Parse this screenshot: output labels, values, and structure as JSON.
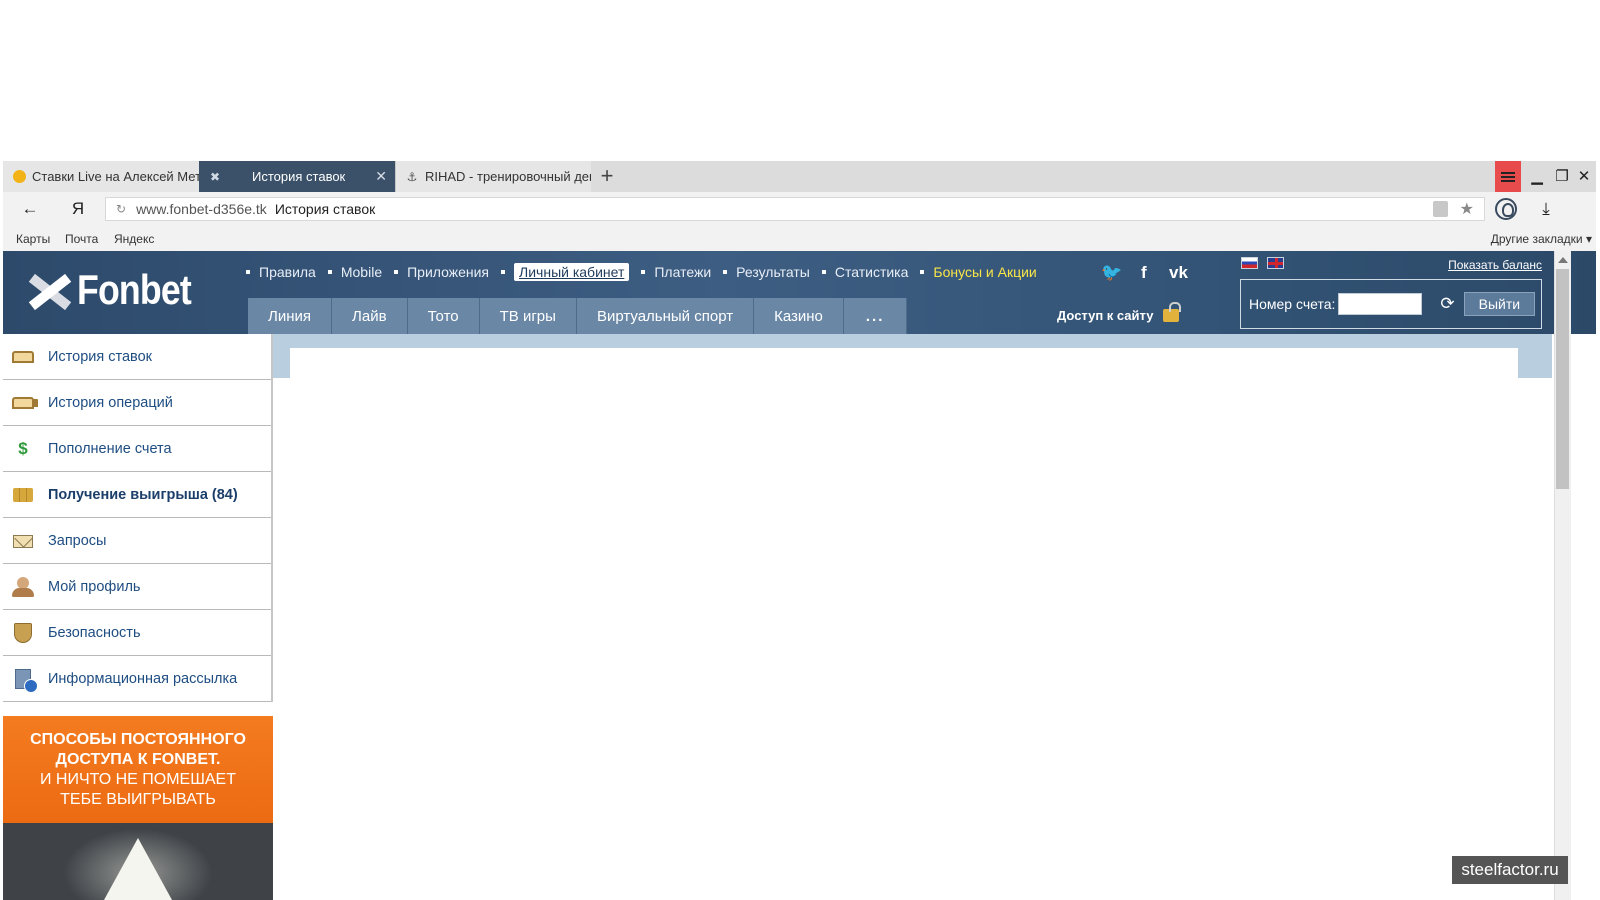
{
  "browser": {
    "tabs": [
      {
        "label": "Ставки Live на Алексей Метёлкин",
        "active": false
      },
      {
        "label": "История ставок",
        "active": true
      },
      {
        "label": "RIHAD - тренировочный день",
        "active": false
      }
    ],
    "new_tab_symbol": "+",
    "close_symbol": "✕",
    "back_symbol": "←",
    "yandex_button": "Я",
    "address": {
      "domain": "www.fonbet-d356e.tk",
      "page_title": "История ставок"
    },
    "bookmarks": [
      "Карты",
      "Почта",
      "Яндекс"
    ],
    "other_bookmarks": "Другие закладки ▾"
  },
  "site": {
    "logo_text": "Fonbet",
    "top_nav": [
      {
        "label": "Правила"
      },
      {
        "label": "Mobile"
      },
      {
        "label": "Приложения"
      },
      {
        "label": "Личный кабинет",
        "active": true
      },
      {
        "label": "Платежи"
      },
      {
        "label": "Результаты"
      },
      {
        "label": "Статистика"
      },
      {
        "label": "Бонусы и Акции",
        "promo": true
      }
    ],
    "social": {
      "twitter": "🐦",
      "facebook": "f",
      "vk": "vk"
    },
    "main_tabs": [
      "Линия",
      "Лайв",
      "Тото",
      "ТВ игры",
      "Виртуальный спорт",
      "Казино",
      "..."
    ],
    "access_label": "Доступ к сайту",
    "show_balance": "Показать баланс",
    "account_label": "Номер счета:",
    "logout_label": "Выйти"
  },
  "sidebar": {
    "items": [
      {
        "label": "История ставок",
        "icon": "book-icon"
      },
      {
        "label": "История операций",
        "icon": "books-icon"
      },
      {
        "label": "Пополнение счета",
        "icon": "dollar-icon"
      },
      {
        "label": "Получение выигрыша (84)",
        "icon": "coins-icon",
        "bold": true
      },
      {
        "label": "Запросы",
        "icon": "mail-icon"
      },
      {
        "label": "Мой профиль",
        "icon": "user-icon"
      },
      {
        "label": "Безопасность",
        "icon": "shield-icon"
      },
      {
        "label": "Информационная рассылка",
        "icon": "newsletter-icon"
      }
    ]
  },
  "banner": {
    "line1": "СПОСОБЫ ПОСТОЯННОГО",
    "line2": "ДОСТУПА К FONBET.",
    "line3": "И НИЧТО НЕ ПОМЕШАЕТ",
    "line4": "ТЕБЕ ВЫИГРЫВАТЬ"
  },
  "watermark": "steelfactor.ru",
  "colors": {
    "header_bg": "#35557a",
    "tab_bg": "#6a88a6",
    "promo": "#f9e548",
    "banner": "#f47b20"
  }
}
